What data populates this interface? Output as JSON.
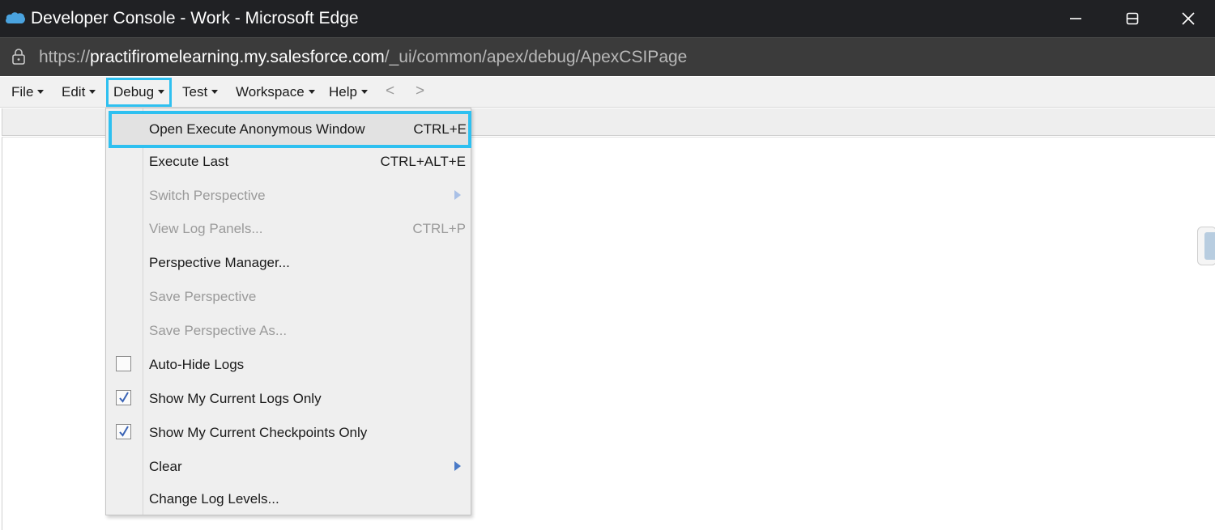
{
  "window": {
    "title": "Developer Console - Work - Microsoft Edge",
    "logo_icon": "salesforce-cloud-icon",
    "controls": [
      "minimize-icon",
      "maximize-icon",
      "close-icon"
    ]
  },
  "address_bar": {
    "scheme": "https://",
    "host": "practifiromelearning.my.salesforce.com",
    "path": "/_ui/common/apex/debug/ApexCSIPage",
    "lock_icon": "lock-icon"
  },
  "menubar": {
    "items": [
      {
        "label": "File"
      },
      {
        "label": "Edit"
      },
      {
        "label": "Debug",
        "active": true
      },
      {
        "label": "Test"
      },
      {
        "label": "Workspace"
      },
      {
        "label": "Help"
      }
    ],
    "back": "<",
    "forward": ">"
  },
  "debug_menu": {
    "items": [
      {
        "label": "Open Execute Anonymous Window",
        "shortcut": "CTRL+E",
        "highlighted": true
      },
      {
        "label": "Execute Last",
        "shortcut": "CTRL+ALT+E"
      },
      {
        "label": "Switch Perspective",
        "disabled": true,
        "submenu": true
      },
      {
        "label": "View Log Panels...",
        "shortcut": "CTRL+P",
        "disabled": true
      },
      {
        "label": "Perspective Manager..."
      },
      {
        "label": "Save Perspective",
        "disabled": true
      },
      {
        "label": "Save Perspective As...",
        "disabled": true
      },
      {
        "label": "Auto-Hide Logs",
        "checkbox": true,
        "checked": false
      },
      {
        "label": "Show My Current Logs Only",
        "checkbox": true,
        "checked": true
      },
      {
        "label": "Show My Current Checkpoints Only",
        "checkbox": true,
        "checked": true
      },
      {
        "label": "Clear",
        "submenu": true
      },
      {
        "label": "Change Log Levels..."
      }
    ]
  },
  "colors": {
    "highlight_border": "#2ec0f0",
    "submenu_arrow": "#4a7ac7",
    "titlebar_bg": "#202124",
    "addressbar_bg": "#3b3b3b"
  }
}
